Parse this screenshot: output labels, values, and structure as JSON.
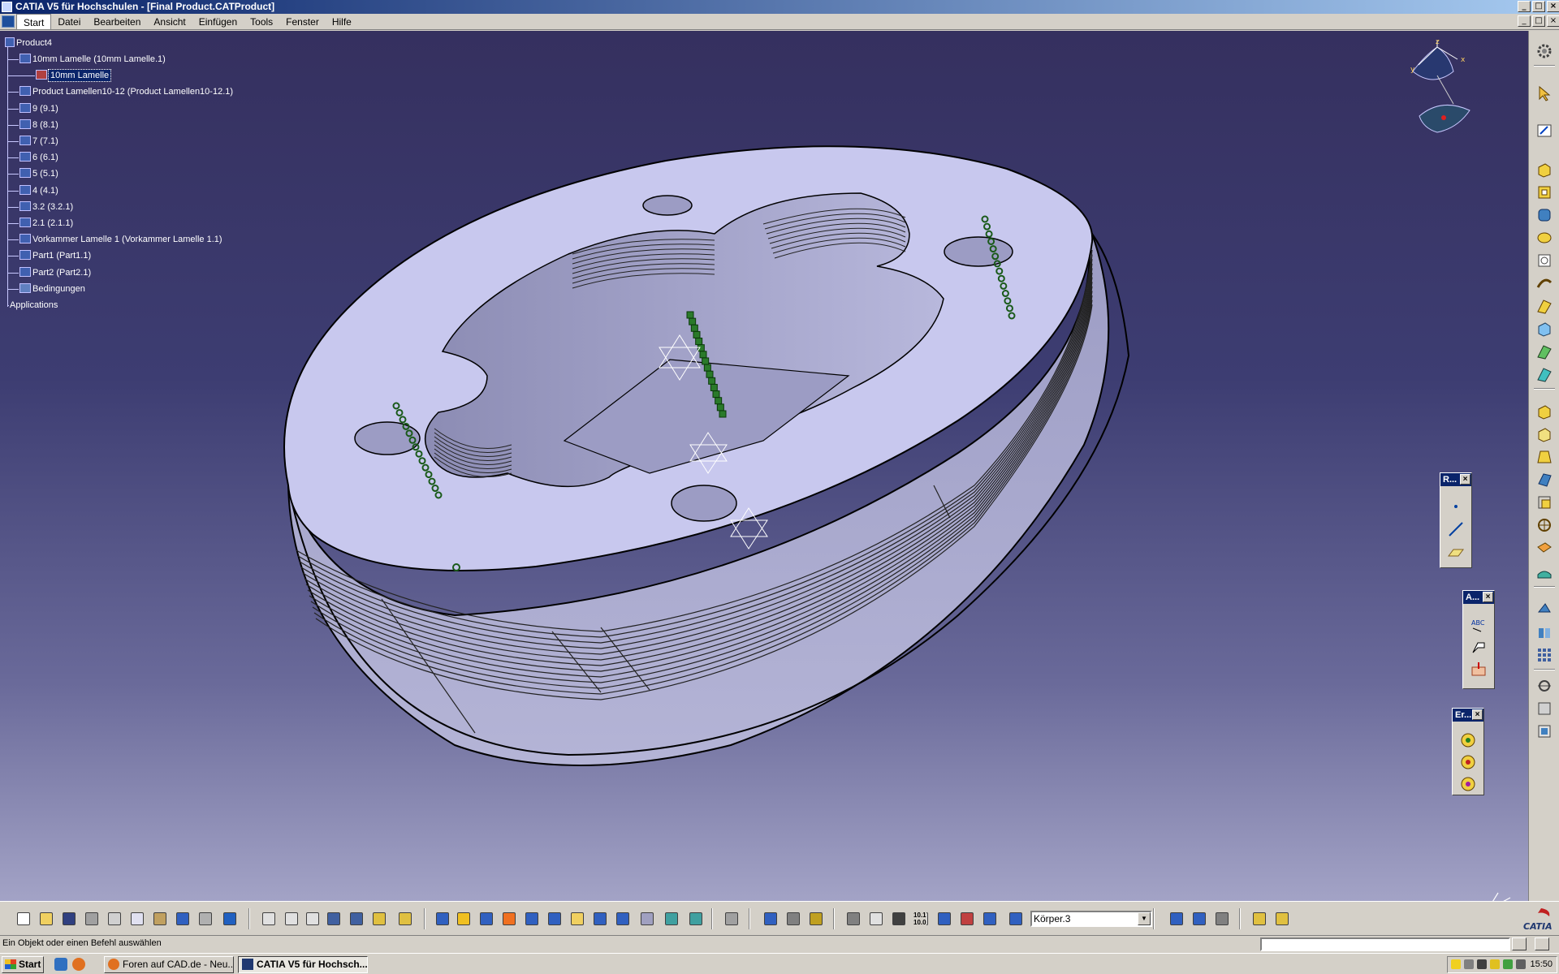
{
  "window": {
    "title": "CATIA V5 für Hochschulen - [Final Product.CATProduct]",
    "minimize": "_",
    "maximize": "□",
    "close": "×"
  },
  "menu": {
    "items": [
      "Start",
      "Datei",
      "Bearbeiten",
      "Ansicht",
      "Einfügen",
      "Tools",
      "Fenster",
      "Hilfe"
    ],
    "active": "Start"
  },
  "tree": {
    "root": "Product4",
    "items": [
      {
        "label": "10mm Lamelle (10mm Lamelle.1)",
        "icon": "product-icon"
      },
      {
        "label": "10mm Lamelle",
        "icon": "part-icon",
        "selected": true
      },
      {
        "label": "Product Lamellen10-12 (Product Lamellen10-12.1)",
        "icon": "product-icon"
      },
      {
        "label": "9 (9.1)",
        "icon": "product-icon"
      },
      {
        "label": "8 (8.1)",
        "icon": "product-icon"
      },
      {
        "label": "7 (7.1)",
        "icon": "product-icon"
      },
      {
        "label": "6 (6.1)",
        "icon": "product-icon"
      },
      {
        "label": "5 (5.1)",
        "icon": "product-icon"
      },
      {
        "label": "4 (4.1)",
        "icon": "product-icon"
      },
      {
        "label": "3.2 (3.2.1)",
        "icon": "product-icon"
      },
      {
        "label": "2.1 (2.1.1)",
        "icon": "product-icon"
      },
      {
        "label": "Vorkammer Lamelle 1 (Vorkammer Lamelle 1.1)",
        "icon": "product-icon"
      },
      {
        "label": "Part1 (Part1.1)",
        "icon": "product-icon"
      },
      {
        "label": "Part2 (Part2.1)",
        "icon": "product-icon"
      },
      {
        "label": "Bedingungen",
        "icon": "constraints-icon"
      },
      {
        "label": "Applications",
        "icon": ""
      }
    ]
  },
  "compass": {
    "z": "z",
    "x": "x",
    "y": "y"
  },
  "floating_toolbars": [
    {
      "title": "R...",
      "close": "×"
    },
    {
      "title": "A...",
      "close": "×"
    },
    {
      "title": "Er...",
      "close": "×"
    }
  ],
  "annotation_icon_text": "ABC",
  "bottom_toolbar": {
    "body_select_value": "Körper.3",
    "scale_text_top": "10.1",
    "scale_text_bottom": "10.0"
  },
  "status": {
    "text": "Ein Objekt oder einen Befehl auswählen"
  },
  "taskbar": {
    "start_label": "Start",
    "tasks": [
      {
        "label": "Foren auf CAD.de - Neu...",
        "active": false
      },
      {
        "label": "CATIA V5 für Hochsch...",
        "active": true
      }
    ],
    "clock": "15:50"
  },
  "logo": {
    "text": "CATIA"
  },
  "colors": {
    "title_bar_start": "#0a246a",
    "viewport_top": "#35305f",
    "viewport_bottom": "#a3a3c6",
    "model_face": "#c8c8ee",
    "model_side": "#a0a0c4"
  }
}
